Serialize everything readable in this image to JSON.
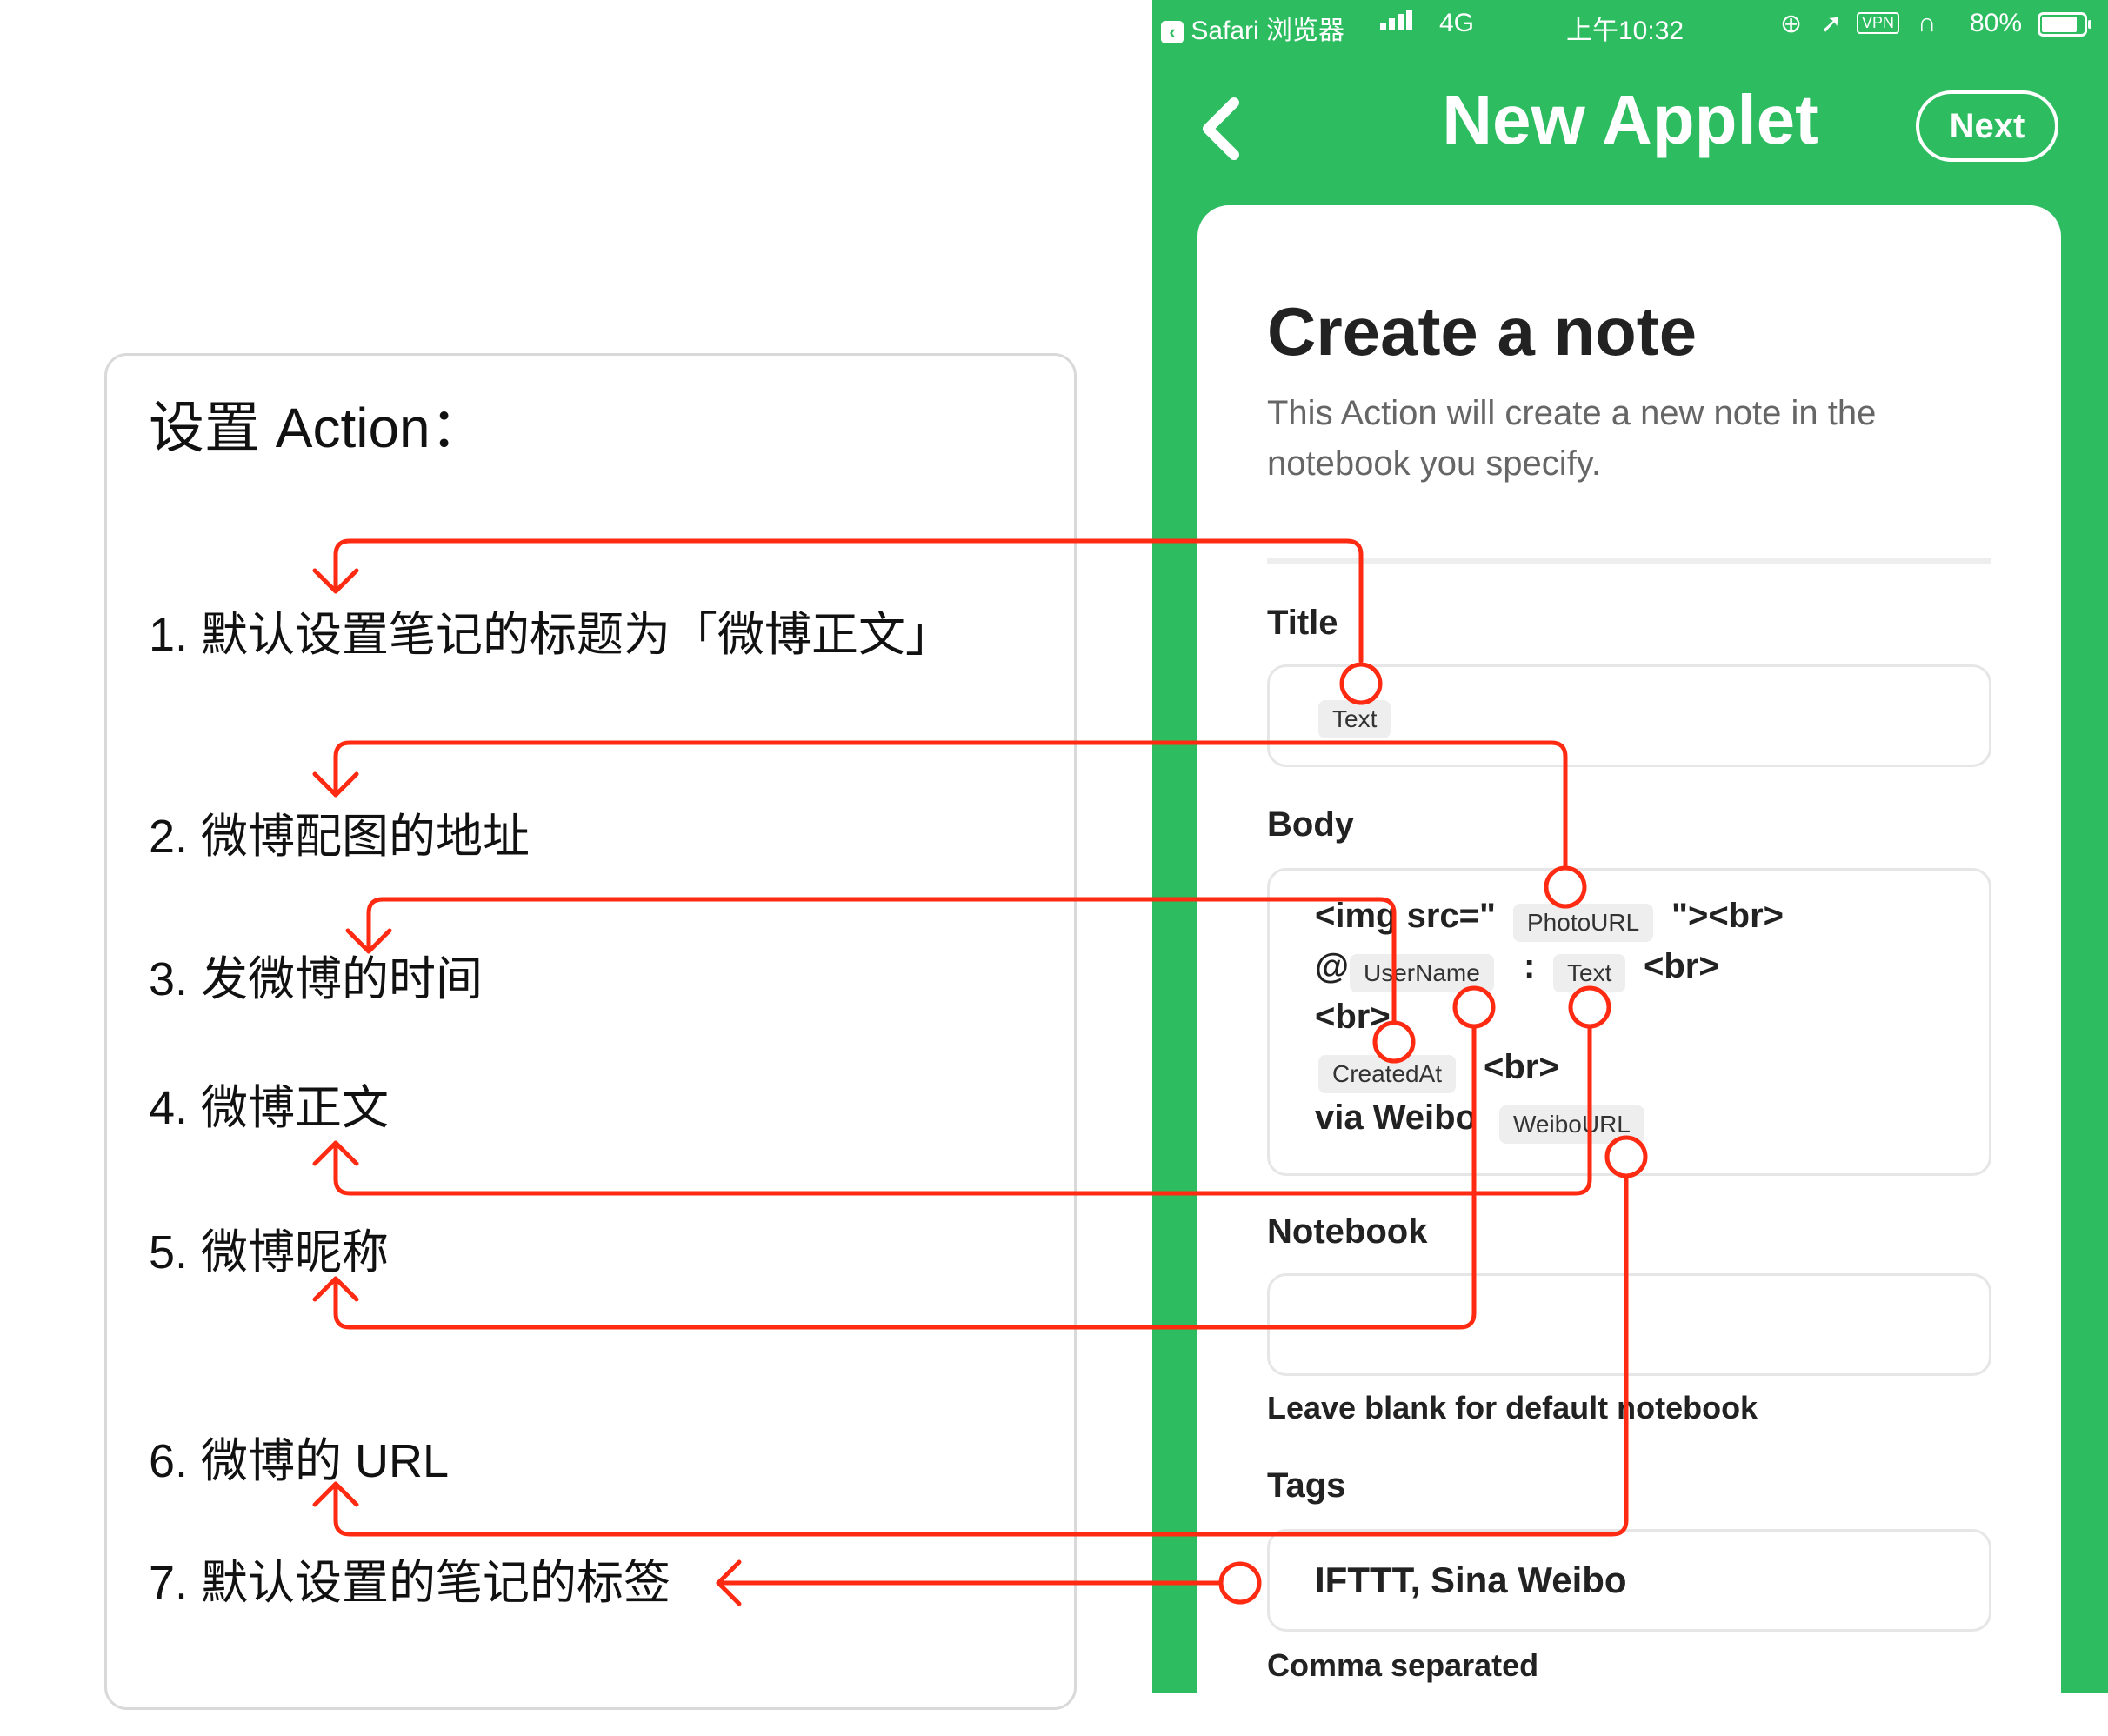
{
  "left_panel": {
    "heading": "设置 Action：",
    "notes": [
      "1. 默认设置笔记的标题为「微博正文」",
      "2. 微博配图的地址",
      "3. 发微博的时间",
      "4. 微博正文",
      "5. 微博昵称",
      "6. 微博的 URL",
      "7. 默认设置的笔记的标签"
    ]
  },
  "status_bar": {
    "back_app": "Safari 浏览器",
    "network": "4G",
    "time": "上午10:32",
    "vpn": "VPN",
    "battery": "80%"
  },
  "header": {
    "title": "New Applet",
    "next_label": "Next"
  },
  "card": {
    "title": "Create a note",
    "description": "This Action will create a new note in the notebook you specify.",
    "title_field": {
      "label": "Title",
      "ingredient": "Text"
    },
    "body_field": {
      "label": "Body",
      "img_open": "<img src=\"",
      "photo_url": "PhotoURL",
      "img_close": "\"><br>",
      "at": "@",
      "user_name": "UserName",
      "colon": ":",
      "text": "Text",
      "br1": "<br>",
      "br2": "<br>",
      "created_at": "CreatedAt",
      "br3": "<br>",
      "via": "via Weibo",
      "weibo_url": "WeiboURL"
    },
    "notebook_field": {
      "label": "Notebook",
      "value": "",
      "helper": "Leave blank for default notebook"
    },
    "tags_field": {
      "label": "Tags",
      "value": "IFTTT, Sina Weibo",
      "helper": "Comma separated"
    }
  },
  "colors": {
    "green": "#2dbd60",
    "arrow_red": "#ff2a12"
  }
}
